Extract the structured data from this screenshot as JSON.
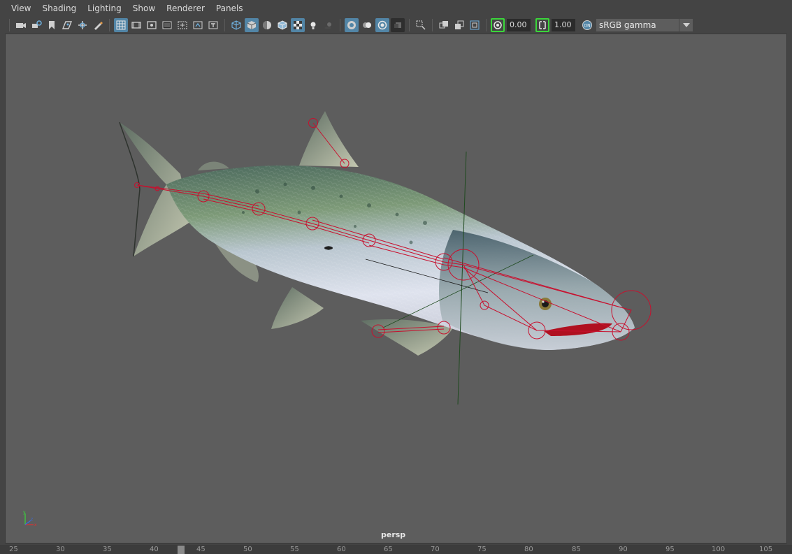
{
  "menubar": {
    "items": [
      "View",
      "Shading",
      "Lighting",
      "Show",
      "Renderer",
      "Panels"
    ]
  },
  "toolbar": {
    "exposure_value": "0.00",
    "gamma_value": "1.00",
    "color_space": "sRGB gamma",
    "icons": [
      "camera-icon",
      "camera-attributes-icon",
      "bookmark-icon",
      "image-plane-icon",
      "two-d-pan-icon",
      "grease-pencil-icon",
      "grid-icon",
      "film-gate-icon",
      "resolution-gate-icon",
      "gate-mask-icon",
      "field-chart-icon",
      "safe-action-icon",
      "safe-title-icon",
      "wireframe-icon",
      "smooth-shade-icon",
      "default-material-icon",
      "shaded-wireframe-icon",
      "textured-icon",
      "lights-icon",
      "shadows-icon",
      "ambient-occlusion-icon",
      "xray-icon",
      "xray-active-components-icon",
      "xray-joints-icon",
      "backface-culling-icon",
      "isolate-select-icon",
      "depth-of-field-icon",
      "hud-icon",
      "multisample-icon",
      "screen-space-ao-icon",
      "exposure-icon",
      "gamma-icon",
      "color-management-icon"
    ]
  },
  "viewport": {
    "camera_label": "persp",
    "background_color": "#5d5d5d",
    "joint_color": "#c8102e"
  },
  "timeline": {
    "ticks": [
      "25",
      "30",
      "35",
      "40",
      "45",
      "50",
      "55",
      "60",
      "65",
      "70",
      "75",
      "80",
      "85",
      "90",
      "95",
      "100",
      "105"
    ]
  }
}
